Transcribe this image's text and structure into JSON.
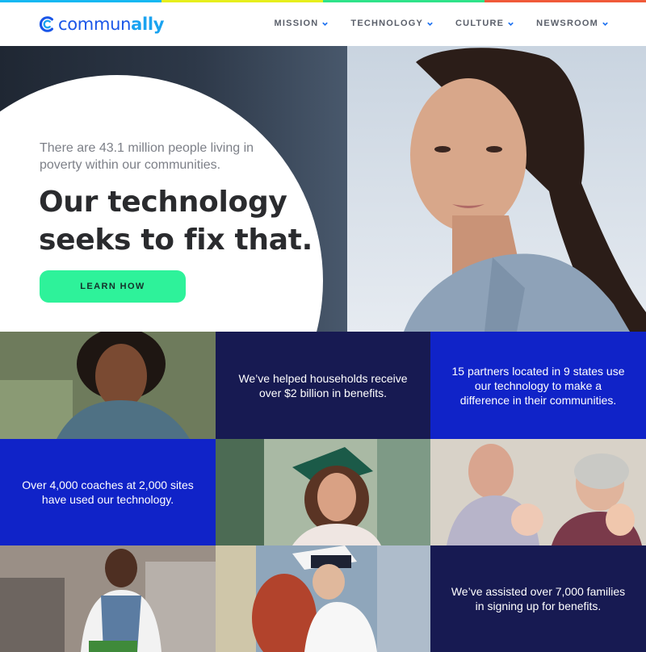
{
  "colors": {
    "stripe": [
      "#16b8f2",
      "#e6ef1c",
      "#2fe38a",
      "#f05a3a"
    ],
    "accent_button": "#2ef29a",
    "tile_navy": "#171a52",
    "tile_blue": "#1023c8",
    "logo_primary": "#1a56e8",
    "logo_secondary": "#1aa3f0"
  },
  "header": {
    "logo": {
      "text_light": "commun",
      "text_bold": "ally",
      "icon": "c-swirl-logo-icon"
    },
    "nav": [
      {
        "label": "MISSION",
        "icon": "chevron-down-icon"
      },
      {
        "label": "TECHNOLOGY",
        "icon": "chevron-down-icon"
      },
      {
        "label": "CULTURE",
        "icon": "chevron-down-icon"
      },
      {
        "label": "NEWSROOM",
        "icon": "chevron-down-icon"
      }
    ]
  },
  "hero": {
    "subtitle": "There are 43.1 million people living in poverty within our communities.",
    "title": "Our technology seeks to fix that.",
    "button_label": "LEARN HOW"
  },
  "tiles": {
    "households": "We’ve helped households receive over $2 billion in benefits.",
    "partners": "15 partners located in 9 states use our technology to make a difference in their communities.",
    "coaches": "Over 4,000 coaches at 2,000 sites have used our technology.",
    "families": "We’ve assisted over 7,000 families in signing up for benefits."
  }
}
